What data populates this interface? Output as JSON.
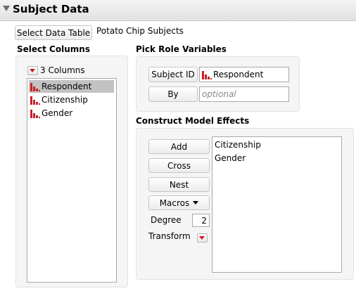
{
  "outline": {
    "title": "Subject Data"
  },
  "data_table": {
    "button_label": "Select Data Table",
    "name": "Potato Chip Subjects"
  },
  "select_columns": {
    "heading": "Select Columns",
    "count_label": "3 Columns",
    "items": [
      {
        "label": "Respondent",
        "selected": true
      },
      {
        "label": "Citizenship",
        "selected": false
      },
      {
        "label": "Gender",
        "selected": false
      }
    ]
  },
  "roles": {
    "heading": "Pick Role Variables",
    "subject_id": {
      "button_label": "Subject ID",
      "value": "Respondent"
    },
    "by": {
      "button_label": "By",
      "placeholder": "optional"
    }
  },
  "model_effects": {
    "heading": "Construct Model Effects",
    "add_label": "Add",
    "cross_label": "Cross",
    "nest_label": "Nest",
    "macros_label": "Macros",
    "degree_label": "Degree",
    "degree_value": "2",
    "transform_label": "Transform",
    "effects": [
      "Citizenship",
      "Gender"
    ]
  },
  "colors": {
    "accent_red": "#c8202a",
    "selection_gray": "#c2c2c2"
  }
}
